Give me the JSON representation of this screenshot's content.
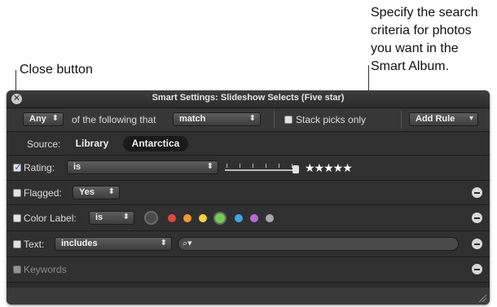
{
  "callouts": {
    "close_button": "Close button",
    "specify_line1": "Specify the search",
    "specify_line2": "criteria for photos",
    "specify_line3": "you want in the",
    "specify_line4": "Smart Album."
  },
  "window": {
    "title": "Smart Settings: Slideshow Selects (Five star)",
    "close_glyph": "✕"
  },
  "criteria_bar": {
    "match_any": "Any",
    "of_text": "of the following that",
    "match_mode": "match",
    "stack_picks_label": "Stack picks only",
    "add_rule": "Add Rule"
  },
  "source": {
    "label": "Source:",
    "options": [
      "Library",
      "Antarctica"
    ],
    "selected": "Antarctica"
  },
  "rules": {
    "rating": {
      "label": "Rating:",
      "operator": "is",
      "checked": true,
      "stars": "★★★★★",
      "value_stars": 5
    },
    "flagged": {
      "label": "Flagged:",
      "value": "Yes",
      "checked": false
    },
    "color_label": {
      "label": "Color Label:",
      "operator": "is",
      "checked": false,
      "colors": [
        "#e2463f",
        "#f39a2c",
        "#f1d23a",
        "#6fcf48",
        "#3ea6ec",
        "#b669d9",
        "#a8a8a8"
      ]
    },
    "text": {
      "label": "Text:",
      "operator": "includes",
      "checked": false,
      "search_glyph": "⌕▾"
    },
    "keywords": {
      "label": "Keywords",
      "checked": false
    }
  },
  "colors": {
    "panel_bg": "#2b2b2b",
    "selected_source": "#1a1a1a"
  }
}
